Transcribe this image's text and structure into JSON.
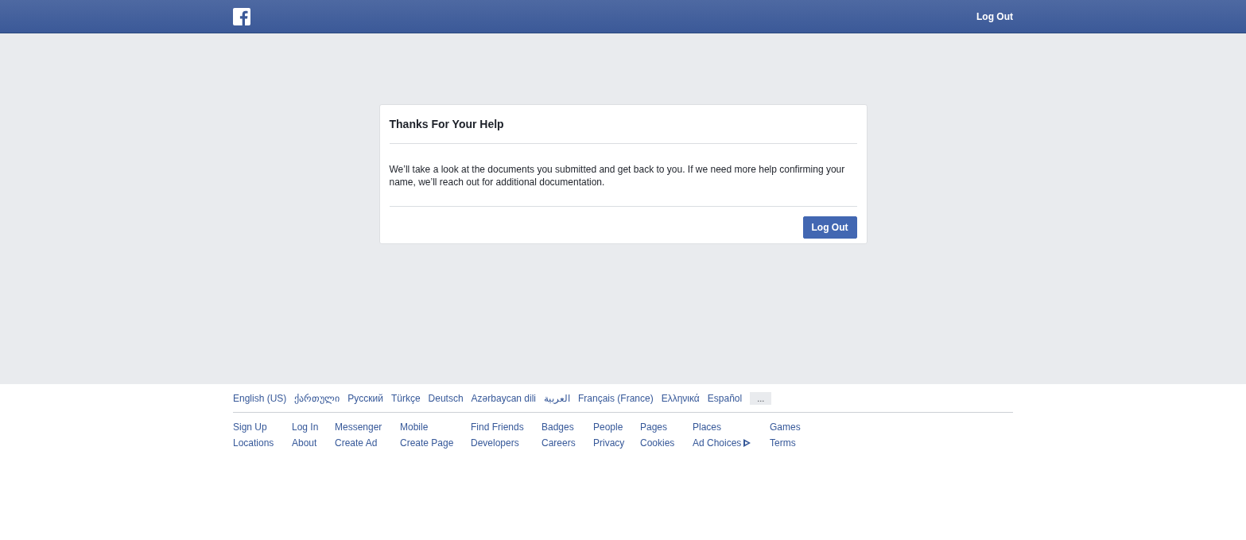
{
  "header": {
    "logout": "Log Out"
  },
  "dialog": {
    "title": "Thanks For Your Help",
    "message": "We’ll take a look at the documents you submitted and get back to you. If we need more help confirming your name, we’ll reach out for additional documentation.",
    "button": "Log Out"
  },
  "footer": {
    "languages": [
      "English (US)",
      "ქართული",
      "Русский",
      "Türkçe",
      "Deutsch",
      "Azərbaycan dili",
      "العربية",
      "Français (France)",
      "Ελληνικά",
      "Español"
    ],
    "more": "...",
    "links": [
      [
        "Sign Up",
        "Locations"
      ],
      [
        "Log In",
        "About"
      ],
      [
        "Messenger",
        "Create Ad"
      ],
      [
        "Mobile",
        "Create Page"
      ],
      [
        "Find Friends",
        "Developers"
      ],
      [
        "Badges",
        "Careers"
      ],
      [
        "People",
        "Privacy"
      ],
      [
        "Pages",
        "Cookies"
      ],
      [
        {
          "text": "Places"
        },
        {
          "text": "Ad Choices",
          "kind": "adchoices"
        }
      ],
      [
        "Games",
        "Terms"
      ]
    ]
  }
}
